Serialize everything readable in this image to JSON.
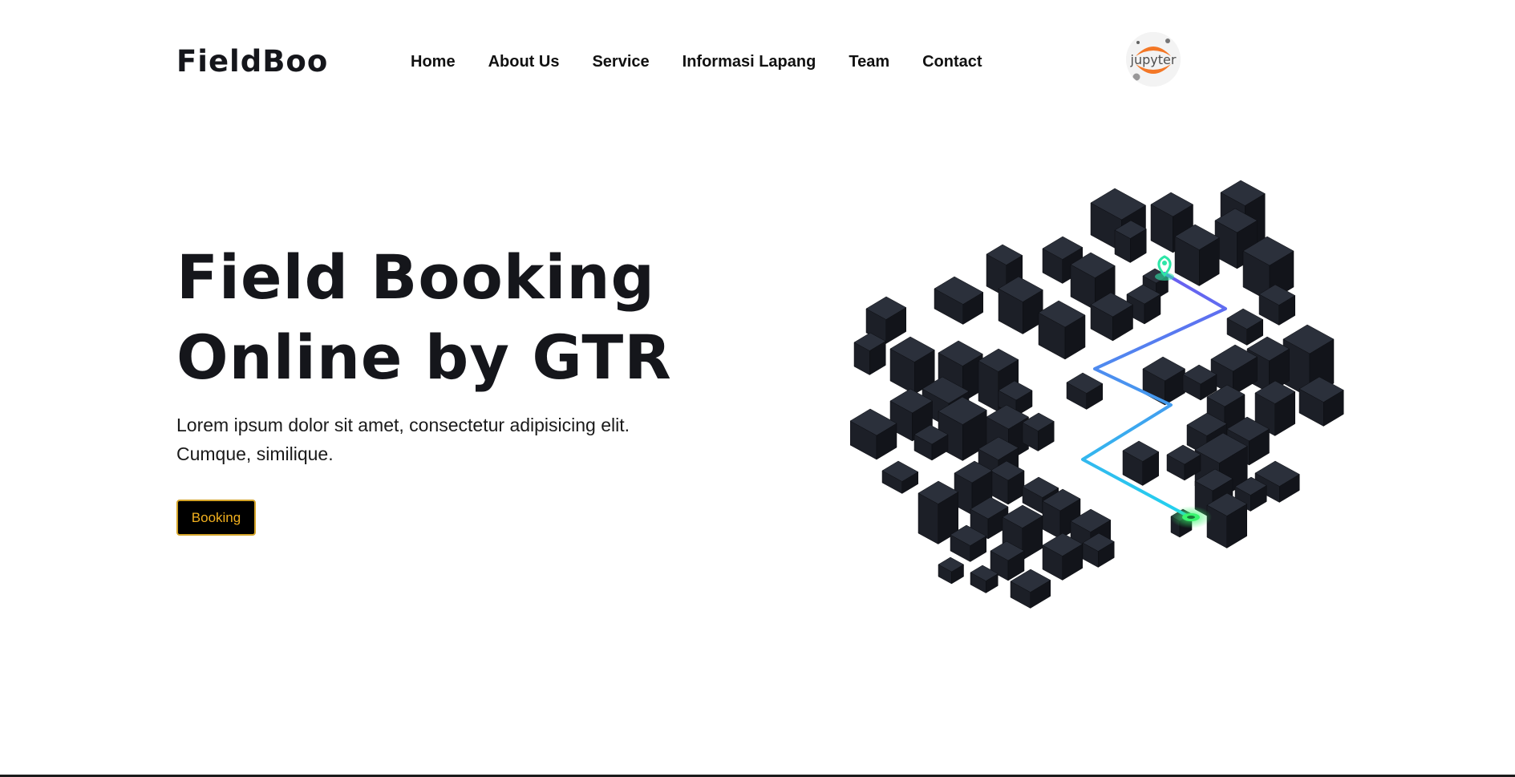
{
  "brand": {
    "name": "FieldBoo"
  },
  "nav": {
    "items": [
      {
        "label": "Home"
      },
      {
        "label": "About Us"
      },
      {
        "label": "Service"
      },
      {
        "label": "Informasi Lapang"
      },
      {
        "label": "Team"
      },
      {
        "label": "Contact"
      }
    ]
  },
  "avatar": {
    "text": "jupyter"
  },
  "hero": {
    "title_line1": "Field Booking",
    "title_line2": "Online by GTR",
    "description_line1": "Lorem ipsum dolor sit amet, consectetur adipisicing elit.",
    "description_line2": "Cumque, similique.",
    "button_label": "Booking"
  },
  "colors": {
    "button_border": "#d4a429",
    "button_text": "#f2b01e",
    "cube_top": "#2b303b",
    "cube_left": "#1c1f27",
    "cube_right": "#12141a",
    "path_start": "#6a5cf0",
    "path_end": "#22d3ee",
    "pin_start": "#2ee6a8",
    "pin_end": "#39f56e"
  }
}
